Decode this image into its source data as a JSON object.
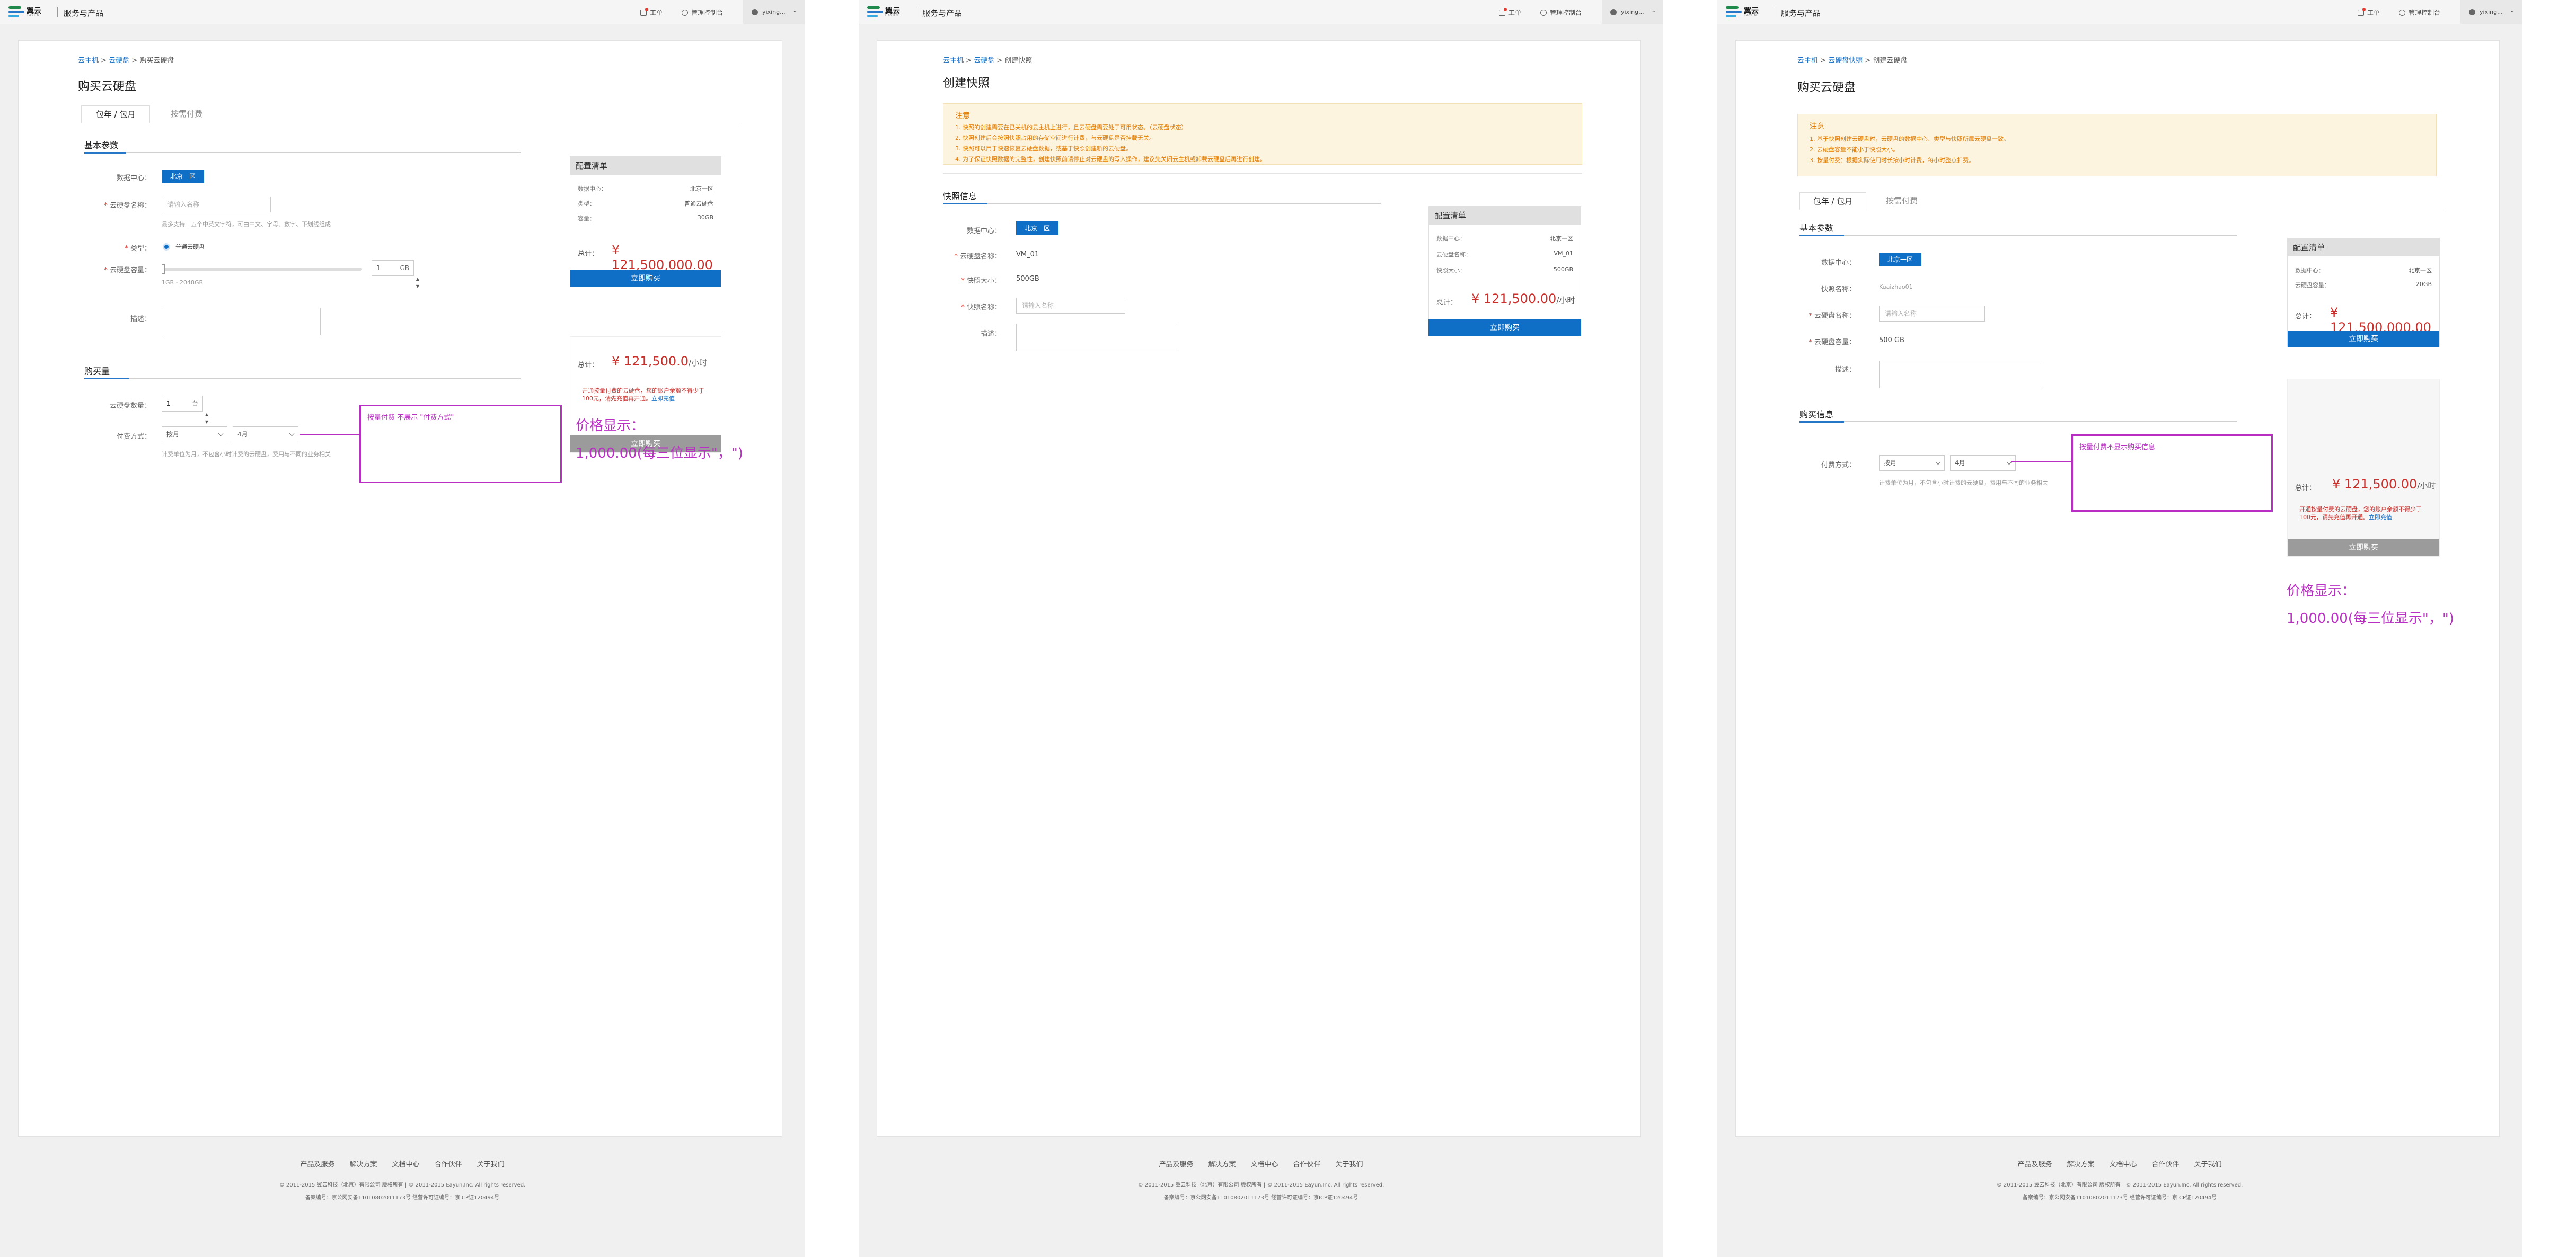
{
  "header": {
    "logo_name": "翼云",
    "logo_sub": "EAYUN",
    "service": "服务与产品",
    "worksheet": "工单",
    "console": "管理控制台",
    "user": "yixing..."
  },
  "page1": {
    "breadcrumb": [
      "云主机",
      "云硬盘",
      "购买云硬盘"
    ],
    "title": "购买云硬盘",
    "tabs": [
      "包年 / 包月",
      "按需付费"
    ],
    "basic_section": "基本参数",
    "datacenter_label": "数据中心：",
    "datacenter_value": "北京一区",
    "name_label": "云硬盘名称：",
    "name_placeholder": "请输入名称",
    "name_hint": "最多支持十五个中英文字符，可由中文、字母、数字、下划线组成",
    "type_label": "类型：",
    "type_value": "普通云硬盘",
    "capacity_label": "云硬盘容量：",
    "capacity_value": "1",
    "capacity_unit": "GB",
    "capacity_range": "1GB - 2048GB",
    "desc_label": "描述：",
    "purchase_section": "购买量",
    "qty_label": "云硬盘数量：",
    "qty_value": "1",
    "qty_unit": "台",
    "pay_label": "付费方式：",
    "pay_value1": "按月",
    "pay_value2": "4月",
    "pay_hint": "计费单位为月，不包含小时计费的云硬盘，费用与不同的业务相关",
    "panel_title": "配置清单",
    "panel_rows": [
      {
        "k": "数据中心：",
        "v": "北京一区"
      },
      {
        "k": "类型：",
        "v": "普通云硬盘"
      },
      {
        "k": "容量：",
        "v": "30GB"
      }
    ],
    "total_label1": "总计：",
    "price1": "¥ 121,500,000.00",
    "buy_label": "立即购买",
    "total_label2": "总计：",
    "price2": "¥ 121,500.0",
    "price2_unit": "/小时",
    "warn": "开通按量付费的云硬盘，您的账户余额不得少于100元，请先充值再开通。",
    "warn_link": "立即充值",
    "buy_label_gray": "立即购买",
    "annot_text": "按量付费 不展示 \"付费方式\"",
    "note_line1": "价格显示：",
    "note_line2": "1,000.00(每三位显示\"，\")"
  },
  "page2": {
    "breadcrumb": [
      "云主机",
      "云硬盘",
      "创建快照"
    ],
    "title": "创建快照",
    "notice_title": "注意",
    "notice_lines": [
      "1. 快照的创建需要在已关机的云主机上进行，且云硬盘需要处于可用状态。（云硬盘状态）",
      "2. 快照创建后会按照快照占用的存储空间进行计费，与云硬盘是否挂载无关。",
      "3. 快照可以用于快速恢复云硬盘数据，或基于快照创建新的云硬盘。",
      "4. 为了保证快照数据的完整性，创建快照前请停止对云硬盘的写入操作，建议先关闭云主机或卸载云硬盘后再进行创建。"
    ],
    "info_section": "快照信息",
    "datacenter_label": "数据中心：",
    "datacenter_value": "北京一区",
    "disk_label": "云硬盘名称：",
    "disk_value": "VM_01",
    "size_label": "快照大小：",
    "size_value": "500GB",
    "snap_label": "快照名称：",
    "snap_placeholder": "请输入名称",
    "desc_label": "描述：",
    "panel_title": "配置清单",
    "panel_rows": [
      {
        "k": "数据中心：",
        "v": "北京一区"
      },
      {
        "k": "云硬盘名称：",
        "v": "VM_01"
      },
      {
        "k": "快照大小：",
        "v": "500GB"
      }
    ],
    "total_label": "总计：",
    "price": "¥ 121,500.00",
    "price_unit": "/小时",
    "buy_label": "立即购买"
  },
  "page3": {
    "breadcrumb": [
      "云主机",
      "云硬盘快照",
      "创建云硬盘"
    ],
    "title": "购买云硬盘",
    "notice_title": "注意",
    "notice_lines": [
      "1. 基于快照创建云硬盘时，云硬盘的数据中心、类型与快照所属云硬盘一致。",
      "2. 云硬盘容量不能小于快照大小。",
      "3. 按量付费：根据实际使用时长按小时计费，每小时整点扣费。"
    ],
    "tabs": [
      "包年 / 包月",
      "按需付费"
    ],
    "basic_section": "基本参数",
    "datacenter_label": "数据中心：",
    "datacenter_value": "北京一区",
    "snap_label": "快照名称：",
    "snap_value": "Kuaizhao01",
    "name_label": "云硬盘名称：",
    "name_placeholder": "请输入名称",
    "capacity_label": "云硬盘容量：",
    "capacity_value": "500",
    "capacity_unit": "GB",
    "desc_label": "描述：",
    "purchase_section": "购买信息",
    "pay_label": "付费方式：",
    "pay_value1": "按月",
    "pay_value2": "4月",
    "pay_hint": "计费单位为月，不包含小时计费的云硬盘，费用与不同的业务相关",
    "panel_title": "配置清单",
    "panel_rows": [
      {
        "k": "数据中心：",
        "v": "北京一区"
      },
      {
        "k": "云硬盘容量：",
        "v": "20GB"
      }
    ],
    "total_label1": "总计：",
    "price1": "¥ 121,500,000.00",
    "buy_label": "立即购买",
    "total_label2": "总计：",
    "price2": "¥ 121,500.00",
    "price2_unit": "/小时",
    "warn": "开通按量付费的云硬盘，您的账户余额不得少于100元，请先充值再开通。",
    "warn_link": "立即充值",
    "buy_label_gray": "立即购买",
    "annot_text": "按量付费不显示购买信息",
    "note_line1": "价格显示：",
    "note_line2": "1,000.00(每三位显示\"，\")"
  },
  "footer": {
    "links": [
      "产品及服务",
      "解决方案",
      "文档中心",
      "合作伙伴",
      "关于我们"
    ],
    "copyright": "© 2011-2015 翼云科技（北京）有限公司 版权所有 | © 2011-2015 Eayun,Inc. All rights reserved.",
    "icp": "备案编号：京公网安备11010802011173号 经营许可证编号：京ICP证120494号"
  }
}
